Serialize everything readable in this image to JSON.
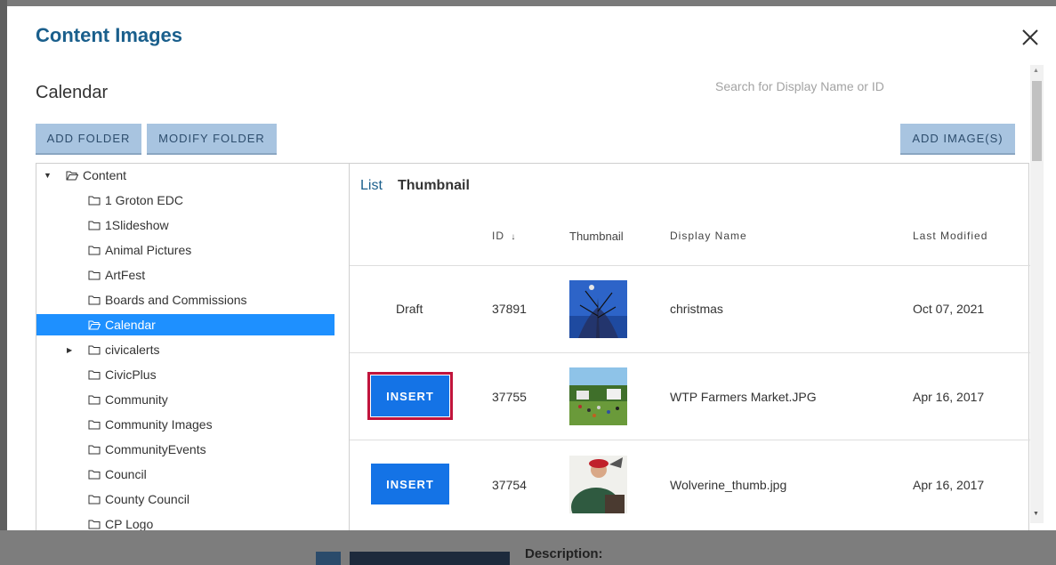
{
  "modal": {
    "title": "Content Images",
    "folder_heading": "Calendar",
    "search_placeholder": "Search for Display Name or ID",
    "buttons": {
      "add_folder": "ADD FOLDER",
      "modify_folder": "MODIFY FOLDER",
      "add_images": "ADD IMAGE(S)"
    }
  },
  "tree": {
    "root": "Content",
    "items": [
      "1 Groton EDC",
      "1Slideshow",
      "Animal Pictures",
      "ArtFest",
      "Boards and Commissions",
      "Calendar",
      "civicalerts",
      "CivicPlus",
      "Community",
      "Community Images",
      "CommunityEvents",
      "Council",
      "County Council",
      "CP Logo"
    ],
    "selected": "Calendar"
  },
  "views": {
    "list": "List",
    "thumbnail": "Thumbnail"
  },
  "table": {
    "headers": {
      "id": "ID",
      "sort_indicator": "↓",
      "thumbnail": "Thumbnail",
      "display_name": "Display Name",
      "last_modified": "Last Modified"
    },
    "rows": [
      {
        "action": "Draft",
        "id": "37891",
        "display_name": "christmas",
        "last_modified": "Oct 07, 2021"
      },
      {
        "action": "INSERT",
        "id": "37755",
        "display_name": "WTP Farmers Market.JPG",
        "last_modified": "Apr 16, 2017"
      },
      {
        "action": "INSERT",
        "id": "37754",
        "display_name": "Wolverine_thumb.jpg",
        "last_modified": "Apr 16, 2017"
      }
    ]
  },
  "background": {
    "description_label": "Description:"
  },
  "colors": {
    "title": "#1a5f8c",
    "selected": "#1e90ff",
    "insert": "#1473e6",
    "focus_outline": "#c0143c",
    "secondary_button": "#a8c4e0"
  }
}
